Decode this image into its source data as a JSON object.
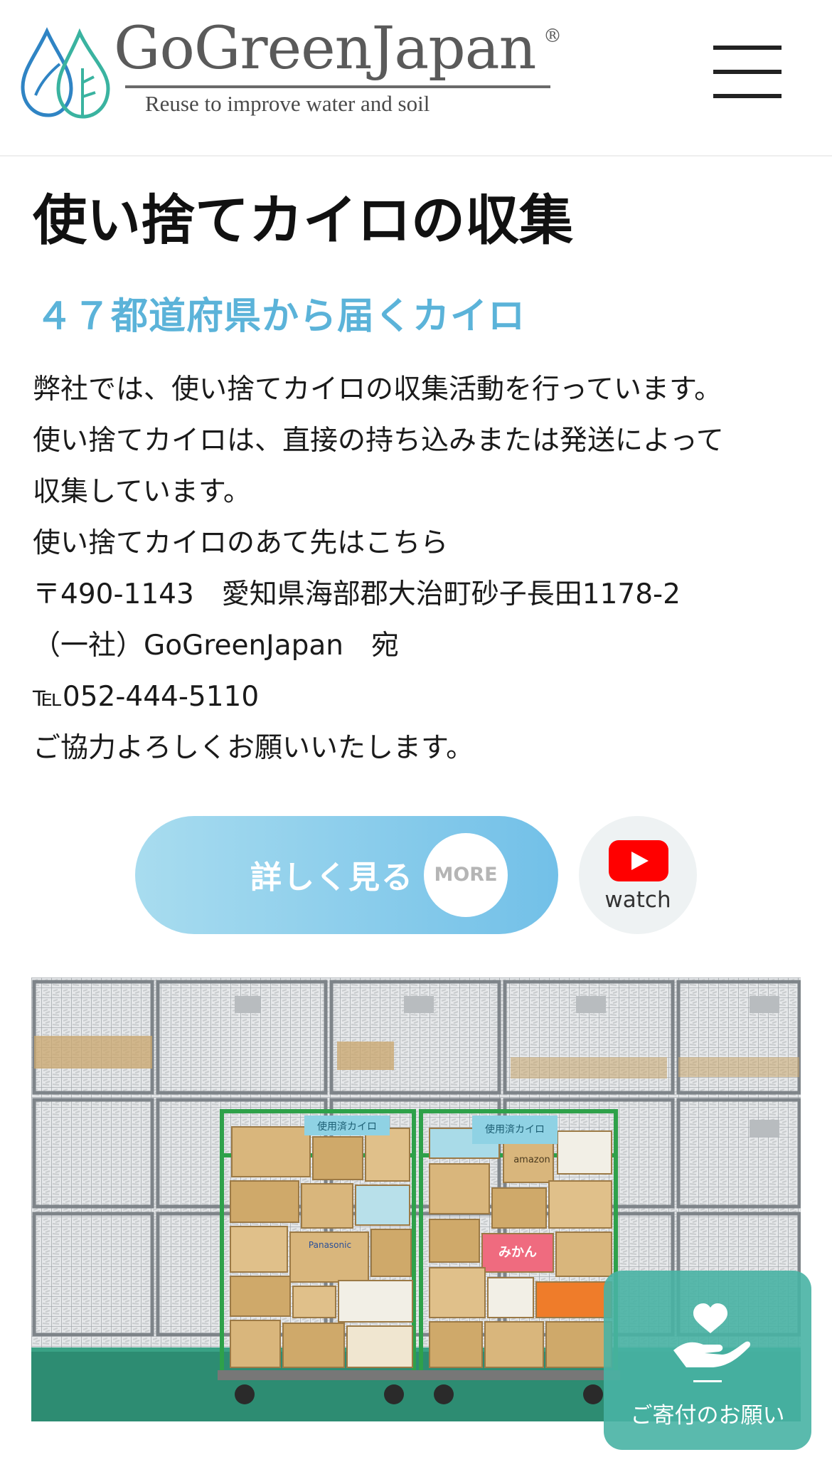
{
  "header": {
    "logo_name": "GoGreenJapan",
    "logo_registered": "®",
    "logo_tagline": "Reuse to improve water and soil",
    "menu_icon": "hamburger-menu-icon"
  },
  "main": {
    "title": "使い捨てカイロの収集",
    "subtitle": "４７都道府県から届くカイロ",
    "paragraphs": [
      "弊社では、使い捨てカイロの収集活動を行っています。",
      "使い捨てカイロは、直接の持ち込みまたは発送によって",
      "収集しています。",
      "使い捨てカイロのあて先はこちら",
      "〒490-1143　愛知県海部郡大治町砂子長田1178-2",
      "（一社）GoGreenJapan　宛",
      "℡052-444-5110",
      "ご協力よろしくお願いいたします。"
    ],
    "more_button_label": "詳しく見る",
    "more_badge": "MORE",
    "watch_label": "watch",
    "watch_icon": "youtube-icon",
    "photo_labels": {
      "cart_sign": "使用済カイロ",
      "box_1": "amazon",
      "box_2": "みかん",
      "box_3": "Panasonic"
    }
  },
  "floating": {
    "donation_label": "ご寄付のお願い",
    "donation_icon": "heart-hand-icon"
  },
  "colors": {
    "accent_blue": "#5bb3d9",
    "button_gradient_start": "#a8dcef",
    "button_gradient_end": "#72c0e8",
    "donation_teal": "#48b2a4",
    "youtube_red": "#ff0000"
  }
}
